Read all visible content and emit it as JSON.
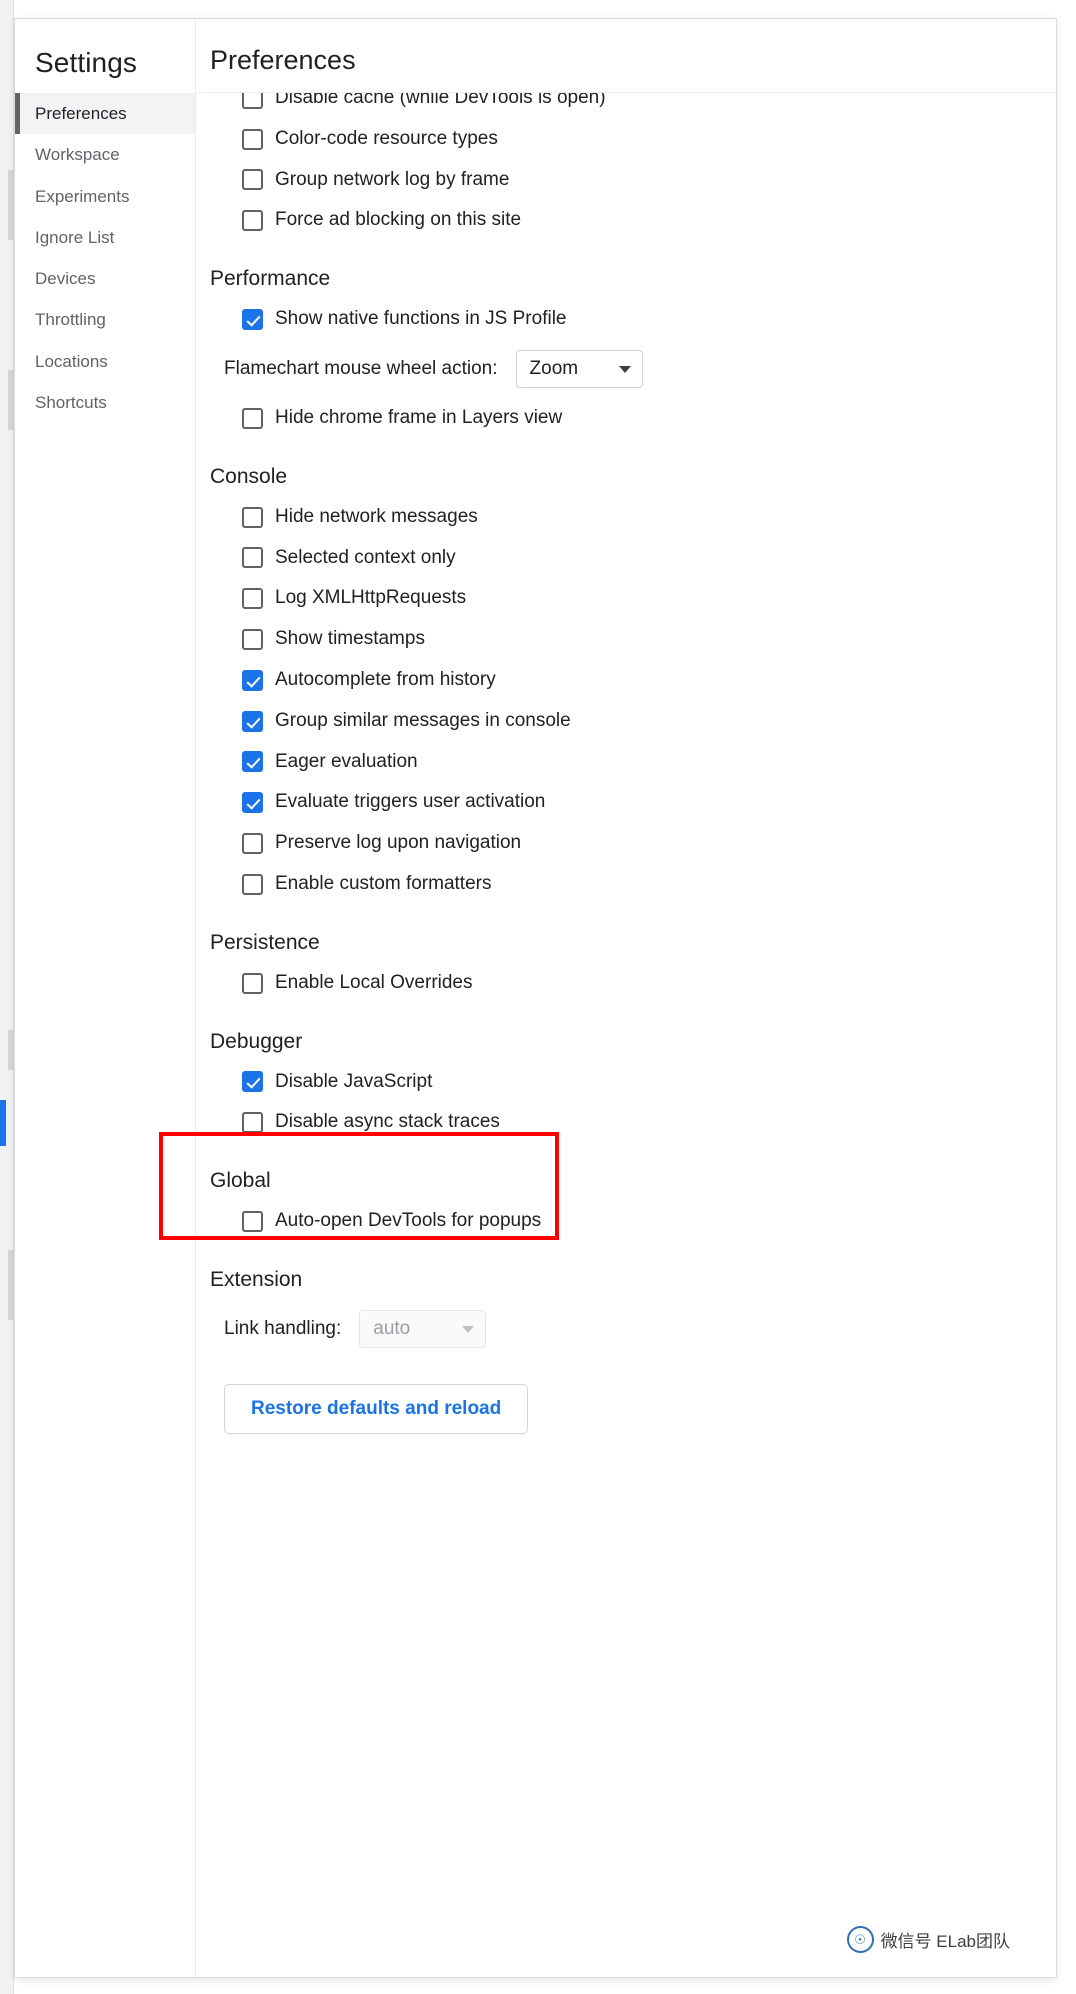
{
  "window": {
    "close_label": "×"
  },
  "sidebar": {
    "title": "Settings",
    "items": [
      {
        "label": "Preferences",
        "selected": true
      },
      {
        "label": "Workspace",
        "selected": false
      },
      {
        "label": "Experiments",
        "selected": false
      },
      {
        "label": "Ignore List",
        "selected": false
      },
      {
        "label": "Devices",
        "selected": false
      },
      {
        "label": "Throttling",
        "selected": false
      },
      {
        "label": "Locations",
        "selected": false
      },
      {
        "label": "Shortcuts",
        "selected": false
      }
    ]
  },
  "main": {
    "title": "Preferences",
    "network_items": [
      {
        "label": "Disable cache (while DevTools is open)",
        "checked": false
      },
      {
        "label": "Color-code resource types",
        "checked": false
      },
      {
        "label": "Group network log by frame",
        "checked": false
      },
      {
        "label": "Force ad blocking on this site",
        "checked": false
      }
    ],
    "performance": {
      "title": "Performance",
      "items": [
        {
          "label": "Show native functions in JS Profile",
          "checked": true
        },
        {
          "label": "Hide chrome frame in Layers view",
          "checked": false
        }
      ],
      "select_label": "Flamechart mouse wheel action:",
      "select_value": "Zoom"
    },
    "console": {
      "title": "Console",
      "items": [
        {
          "label": "Hide network messages",
          "checked": false
        },
        {
          "label": "Selected context only",
          "checked": false
        },
        {
          "label": "Log XMLHttpRequests",
          "checked": false
        },
        {
          "label": "Show timestamps",
          "checked": false
        },
        {
          "label": "Autocomplete from history",
          "checked": true
        },
        {
          "label": "Group similar messages in console",
          "checked": true
        },
        {
          "label": "Eager evaluation",
          "checked": true
        },
        {
          "label": "Evaluate triggers user activation",
          "checked": true
        },
        {
          "label": "Preserve log upon navigation",
          "checked": false
        },
        {
          "label": "Enable custom formatters",
          "checked": false
        }
      ]
    },
    "persistence": {
      "title": "Persistence",
      "items": [
        {
          "label": "Enable Local Overrides",
          "checked": false
        }
      ]
    },
    "debugger": {
      "title": "Debugger",
      "items": [
        {
          "label": "Disable JavaScript",
          "checked": true
        },
        {
          "label": "Disable async stack traces",
          "checked": false
        }
      ]
    },
    "global": {
      "title": "Global",
      "items": [
        {
          "label": "Auto-open DevTools for popups",
          "checked": false
        }
      ]
    },
    "extension": {
      "title": "Extension",
      "select_label": "Link handling:",
      "select_value": "auto"
    },
    "restore_label": "Restore defaults and reload"
  },
  "annotation": {
    "highlight_color": "#ff0000"
  },
  "watermark": {
    "logo_glyph": "☉",
    "text": "微信号 ELab团队"
  },
  "colors": {
    "accent": "#1a73e8",
    "text_primary": "#202124",
    "text_secondary": "#5f6368",
    "selected_bg": "#f1f3f4"
  }
}
